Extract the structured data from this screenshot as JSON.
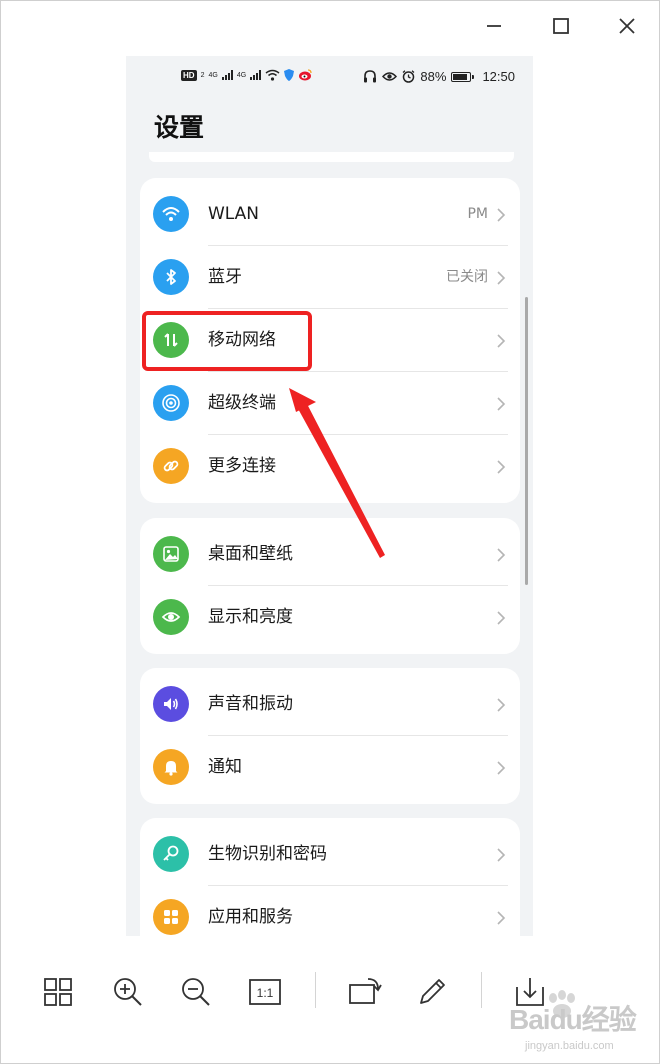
{
  "window": {
    "minimize_icon": "minimize-icon",
    "maximize_icon": "maximize-icon",
    "close_icon": "close-icon"
  },
  "status_bar": {
    "hd_label": "HD",
    "sim_label": "2",
    "sig1": "4G",
    "sig2": "4G",
    "battery_text": "88%",
    "battery_level": 0.88,
    "time": "12:50"
  },
  "settings": {
    "title": "设置",
    "groups": [
      {
        "items": [
          {
            "label": "WLAN",
            "value": "PM",
            "icon": "wifi-icon",
            "color": "#2aa0f0"
          },
          {
            "label": "蓝牙",
            "value": "已关闭",
            "icon": "bluetooth-icon",
            "color": "#2aa0f0"
          },
          {
            "label": "移动网络",
            "value": "",
            "icon": "mobile-data-icon",
            "color": "#4cb84c"
          },
          {
            "label": "超级终端",
            "value": "",
            "icon": "super-device-icon",
            "color": "#2aa0f0"
          },
          {
            "label": "更多连接",
            "value": "",
            "icon": "link-icon",
            "color": "#f5a623"
          }
        ]
      },
      {
        "items": [
          {
            "label": "桌面和壁纸",
            "value": "",
            "icon": "wallpaper-icon",
            "color": "#4cb84c"
          },
          {
            "label": "显示和亮度",
            "value": "",
            "icon": "eye-icon",
            "color": "#4cb84c"
          }
        ]
      },
      {
        "items": [
          {
            "label": "声音和振动",
            "value": "",
            "icon": "speaker-icon",
            "color": "#5b4de0"
          },
          {
            "label": "通知",
            "value": "",
            "icon": "bell-icon",
            "color": "#f5a623"
          }
        ]
      },
      {
        "items": [
          {
            "label": "生物识别和密码",
            "value": "",
            "icon": "key-icon",
            "color": "#2cc0a8"
          },
          {
            "label": "应用和服务",
            "value": "",
            "icon": "apps-icon",
            "color": "#f5a623"
          }
        ]
      }
    ]
  },
  "toolbar": {
    "one_to_one_label": "1:1",
    "buttons": [
      "grid-view-icon",
      "zoom-in-icon",
      "zoom-out-icon",
      "actual-size-icon",
      "rotate-icon",
      "edit-icon",
      "download-icon"
    ]
  },
  "watermark": {
    "main": "Baidu经验",
    "sub": "jingyan.baidu.com"
  },
  "colors": {
    "annotation": "#ee2222",
    "phone_background": "#f1f3f5"
  }
}
